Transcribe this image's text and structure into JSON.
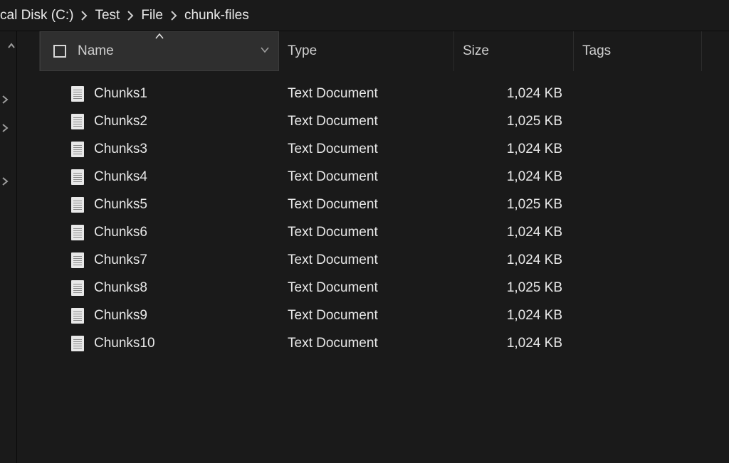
{
  "breadcrumb": {
    "first_fragment": "cal Disk (C:)",
    "items": [
      "Test",
      "File",
      "chunk-files"
    ]
  },
  "columns": {
    "name": "Name",
    "type": "Type",
    "size": "Size",
    "tags": "Tags"
  },
  "files": [
    {
      "name": "Chunks1",
      "type": "Text Document",
      "size": "1,024 KB"
    },
    {
      "name": "Chunks2",
      "type": "Text Document",
      "size": "1,025 KB"
    },
    {
      "name": "Chunks3",
      "type": "Text Document",
      "size": "1,024 KB"
    },
    {
      "name": "Chunks4",
      "type": "Text Document",
      "size": "1,024 KB"
    },
    {
      "name": "Chunks5",
      "type": "Text Document",
      "size": "1,025 KB"
    },
    {
      "name": "Chunks6",
      "type": "Text Document",
      "size": "1,024 KB"
    },
    {
      "name": "Chunks7",
      "type": "Text Document",
      "size": "1,024 KB"
    },
    {
      "name": "Chunks8",
      "type": "Text Document",
      "size": "1,025 KB"
    },
    {
      "name": "Chunks9",
      "type": "Text Document",
      "size": "1,024 KB"
    },
    {
      "name": "Chunks10",
      "type": "Text Document",
      "size": "1,024 KB"
    }
  ]
}
